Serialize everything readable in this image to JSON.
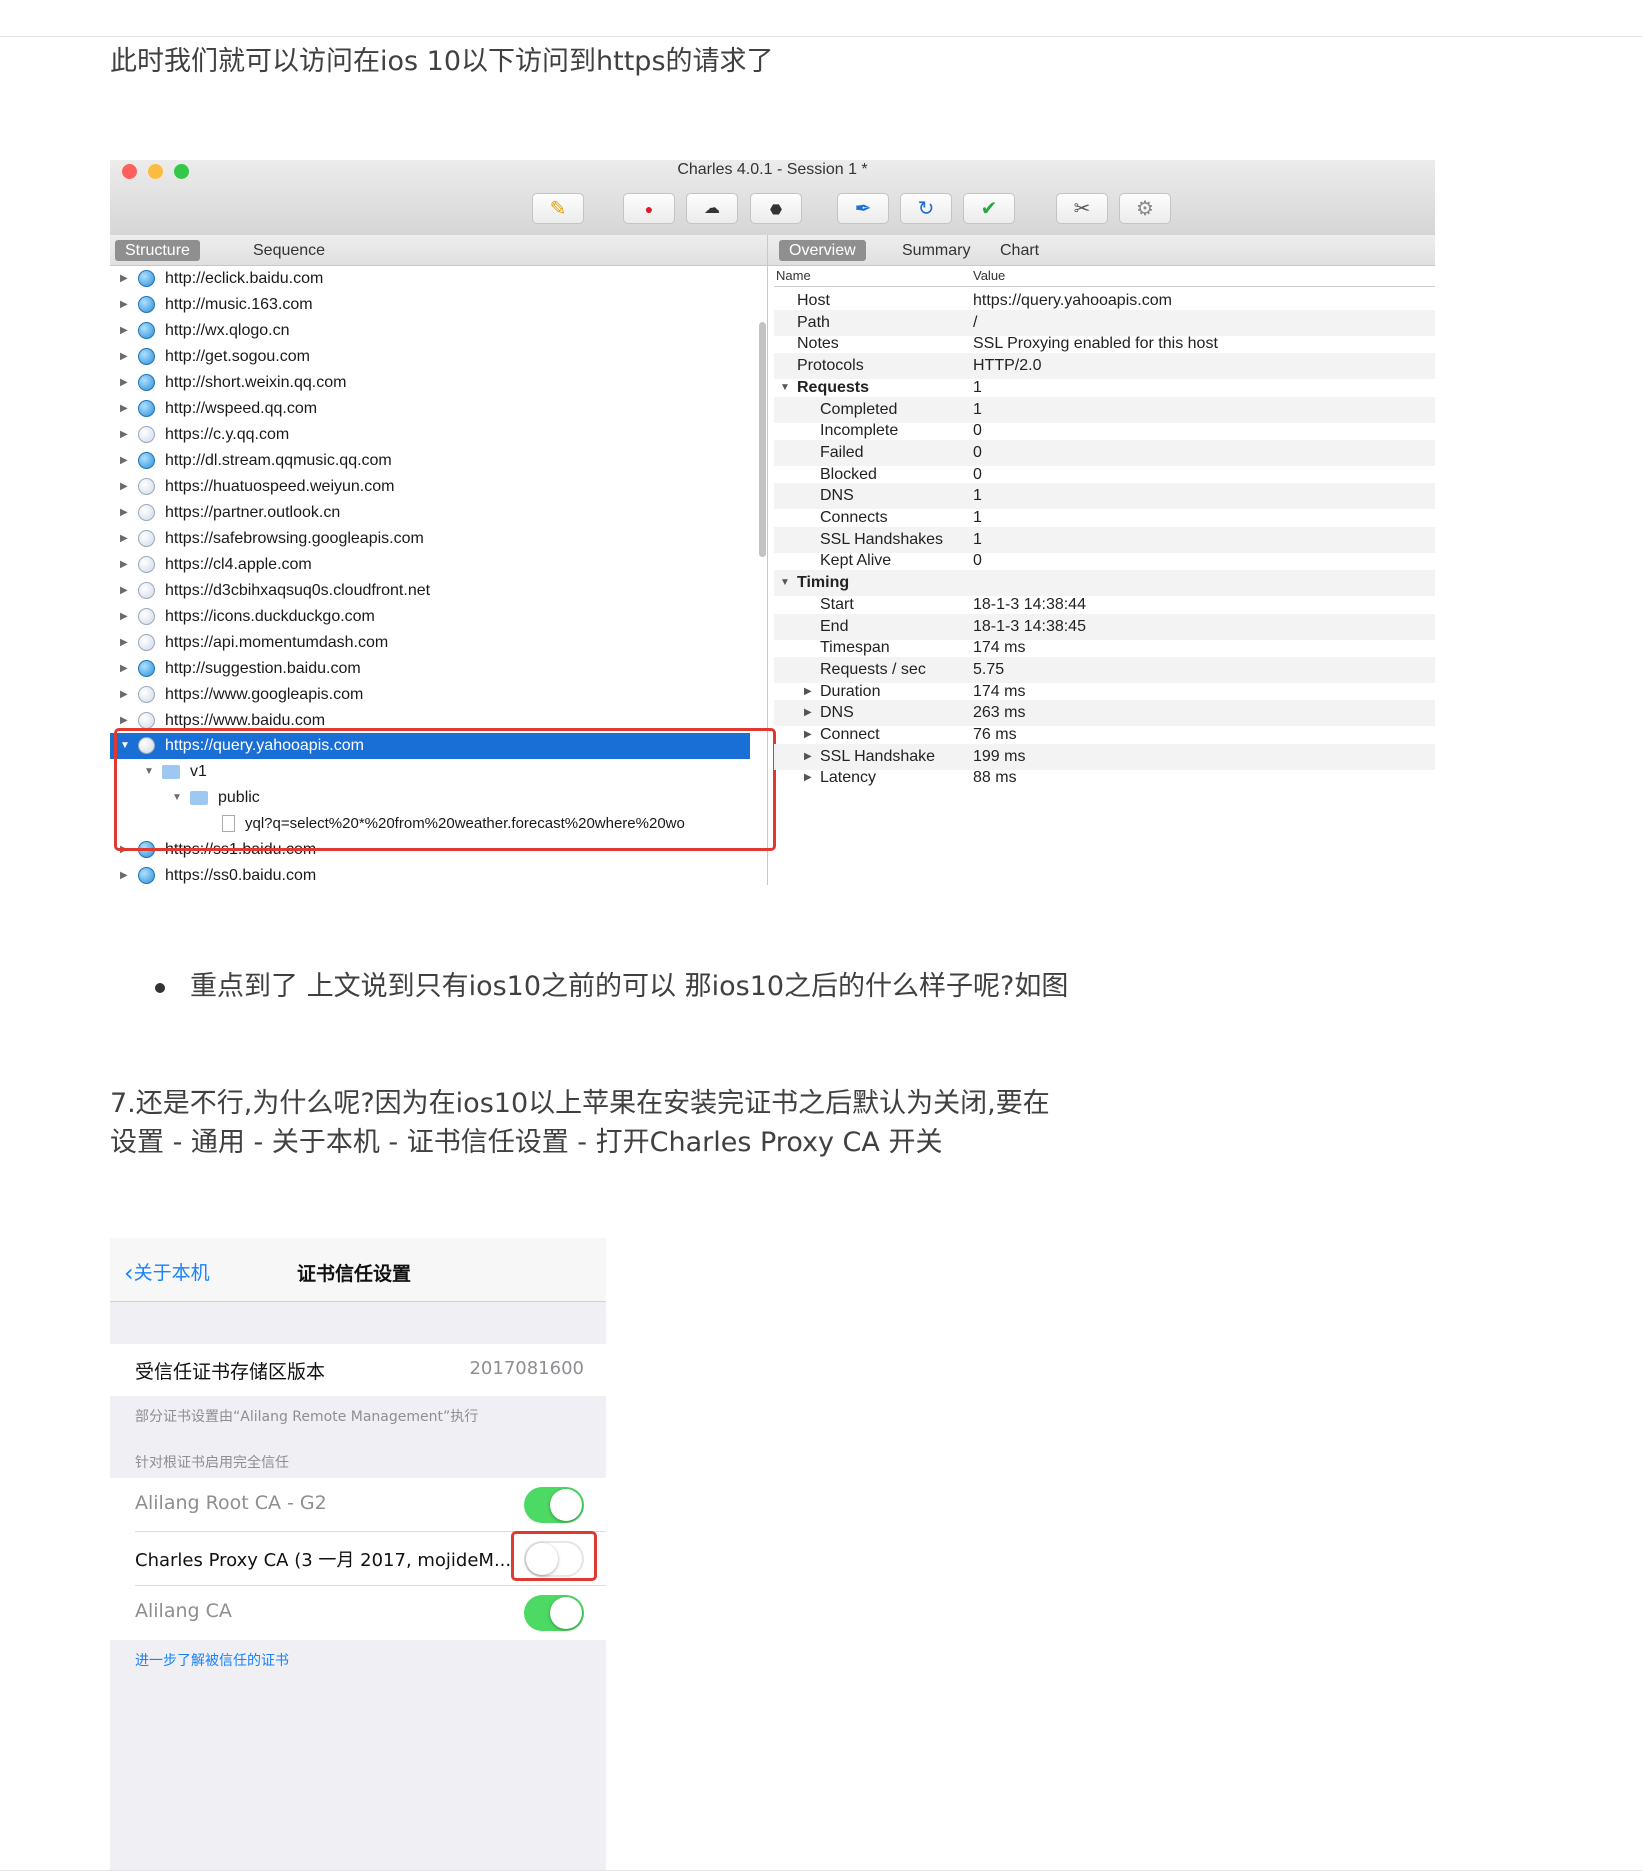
{
  "article": {
    "line1": "此时我们就可以访问在ios 10以下访问到https的请求了",
    "bullet": "重点到了 上文说到只有ios10之前的可以 那ios10之后的什么样子呢?如图",
    "step7_line1": "7.还是不行,为什么呢?因为在ios10以上苹果在安装完证书之后默认为关闭,要在",
    "step7_line2": "设置 - 通用 - 关于本机 - 证书信任设置 - 打开Charles Proxy CA 开关"
  },
  "charles": {
    "window_title": "Charles 4.0.1 - Session 1 *",
    "left_tabs": [
      "Structure",
      "Sequence"
    ],
    "right_tabs": [
      "Overview",
      "Summary",
      "Chart"
    ],
    "toolbar_icons": [
      "pen-icon",
      "record-icon",
      "throttle-icon",
      "stop-icon",
      "compose-icon",
      "refresh-icon",
      "validate-icon",
      "tools-icon",
      "settings-icon"
    ],
    "tree": [
      "http://eclick.baidu.com",
      "http://music.163.com",
      "http://wx.qlogo.cn",
      "http://get.sogou.com",
      "http://short.weixin.qq.com",
      "http://wspeed.qq.com",
      "https://c.y.qq.com",
      "http://dl.stream.qqmusic.qq.com",
      "https://huatuospeed.weiyun.com",
      "https://partner.outlook.cn",
      "https://safebrowsing.googleapis.com",
      "https://cl4.apple.com",
      "https://d3cbihxaqsuq0s.cloudfront.net",
      "https://icons.duckduckgo.com",
      "https://api.momentumdash.com",
      "http://suggestion.baidu.com",
      "https://www.googleapis.com",
      "https://www.baidu.com"
    ],
    "selected_host": "https://query.yahooapis.com",
    "child_v1": "v1",
    "child_public": "public",
    "child_file": "yql?q=select%20*%20from%20weather.forecast%20where%20wo",
    "struck_row": "https://ss1.baidu.com",
    "last_row": "https://ss0.baidu.com",
    "detail_header": {
      "name": "Name",
      "value": "Value"
    },
    "overview": [
      {
        "name": "Host",
        "value": "https://query.yahooapis.com"
      },
      {
        "name": "Path",
        "value": "/"
      },
      {
        "name": "Notes",
        "value": "SSL Proxying enabled for this host"
      },
      {
        "name": "Protocols",
        "value": "HTTP/2.0"
      },
      {
        "name": "Requests",
        "value": "1"
      },
      {
        "name": "Completed",
        "value": "1"
      },
      {
        "name": "Incomplete",
        "value": "0"
      },
      {
        "name": "Failed",
        "value": "0"
      },
      {
        "name": "Blocked",
        "value": "0"
      },
      {
        "name": "DNS",
        "value": "1"
      },
      {
        "name": "Connects",
        "value": "1"
      },
      {
        "name": "SSL Handshakes",
        "value": "1"
      },
      {
        "name": "Kept Alive",
        "value": "0"
      },
      {
        "name": "Timing",
        "value": ""
      },
      {
        "name": "Start",
        "value": "18-1-3 14:38:44"
      },
      {
        "name": "End",
        "value": "18-1-3 14:38:45"
      },
      {
        "name": "Timespan",
        "value": "174 ms"
      },
      {
        "name": "Requests / sec",
        "value": "5.75"
      },
      {
        "name": "Duration",
        "value": "174 ms"
      },
      {
        "name": "DNS",
        "value": "263 ms"
      },
      {
        "name": "Connect",
        "value": "76 ms"
      },
      {
        "name": "SSL Handshake",
        "value": "199 ms"
      },
      {
        "name": "Latency",
        "value": "88 ms"
      }
    ]
  },
  "ios": {
    "back_label": "关于本机",
    "nav_title": "证书信任设置",
    "store_label": "受信任证书存储区版本",
    "store_value": "2017081600",
    "managed_note": "部分证书设置由“Alilang Remote Management”执行",
    "section_header": "针对根证书启用完全信任",
    "certs": [
      {
        "name": "Alilang Root CA - G2",
        "enabled": true
      },
      {
        "name": "Charles Proxy CA (3 一月 2017, mojideM...",
        "enabled": false
      },
      {
        "name": "Alilang CA",
        "enabled": true
      }
    ],
    "learn_more": "进一步了解被信任的证书",
    "colors": {
      "toggle_on": "#4cd964",
      "link": "#1a82fb",
      "highlight": "#e03a30"
    }
  }
}
